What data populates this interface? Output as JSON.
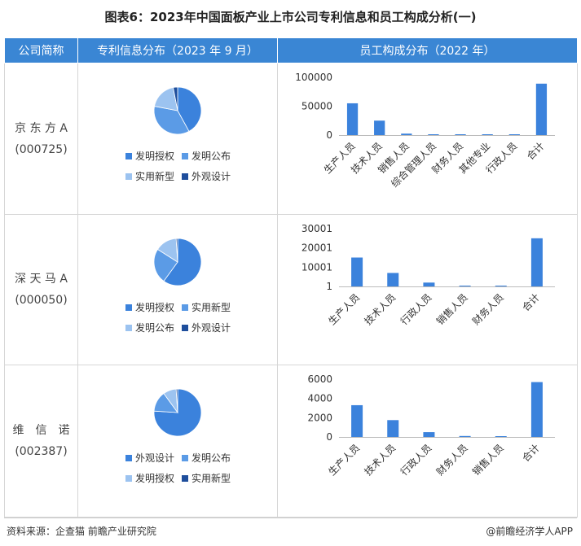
{
  "title": "图表6：2023年中国面板产业上市公司专利信息和员工构成分析(一)",
  "headers": {
    "company": "公司简称",
    "patent": "专利信息分布（2023 年 9 月）",
    "staff": "员工构成分布（2022 年）"
  },
  "rows": [
    {
      "company_name": "京 东 方 A",
      "company_code": "(000725)"
    },
    {
      "company_name": "深 天 马 A",
      "company_code": "(000050)"
    },
    {
      "company_name": "维　信　诺",
      "company_code": "(002387)"
    }
  ],
  "footer": {
    "source": "资料来源：企查猫 前瞻产业研究院",
    "brand": "@前瞻经济学人APP"
  },
  "colors": {
    "header": "#3a86d4",
    "bar": "#3b82dc"
  },
  "chart_data": [
    {
      "type": "pie",
      "company": "京东方A",
      "categories": [
        "发明授权",
        "发明公布",
        "实用新型",
        "外观设计"
      ],
      "values": [
        42,
        36,
        19,
        3
      ],
      "colors": [
        "#3b82dc",
        "#5b9be6",
        "#9cc3f0",
        "#1e4e9c"
      ]
    },
    {
      "type": "bar",
      "company": "京东方A",
      "categories": [
        "生产人员",
        "技术人员",
        "销售人员",
        "综合管理人员",
        "财务人员",
        "其他专业",
        "行政人员",
        "合计"
      ],
      "values": [
        55000,
        25000,
        2500,
        1000,
        900,
        700,
        800,
        89000
      ],
      "ylim": [
        0,
        100000
      ],
      "yticks": [
        "0",
        "50000",
        "100000"
      ],
      "yscale": "linear"
    },
    {
      "type": "pie",
      "company": "深天马A",
      "categories": [
        "发明授权",
        "实用新型",
        "发明公布",
        "外观设计"
      ],
      "values": [
        60,
        24,
        15,
        1
      ],
      "colors": [
        "#3b82dc",
        "#5b9be6",
        "#9cc3f0",
        "#1e4e9c"
      ]
    },
    {
      "type": "bar",
      "company": "深天马A",
      "categories": [
        "生产人员",
        "技术人员",
        "行政人员",
        "销售人员",
        "财务人员",
        "合计"
      ],
      "values": [
        15000,
        7000,
        2000,
        300,
        150,
        25000
      ],
      "ylim": [
        1,
        30001
      ],
      "yticks": [
        "1",
        "10001",
        "20001",
        "30001"
      ],
      "yscale": "linear"
    },
    {
      "type": "pie",
      "company": "维信诺",
      "categories": [
        "外观设计",
        "发明公布",
        "发明授权",
        "实用新型"
      ],
      "values": [
        76,
        14,
        9,
        1
      ],
      "colors": [
        "#3b82dc",
        "#5b9be6",
        "#9cc3f0",
        "#1e4e9c"
      ]
    },
    {
      "type": "bar",
      "company": "维信诺",
      "categories": [
        "生产人员",
        "技术人员",
        "行政人员",
        "财务人员",
        "销售人员",
        "合计"
      ],
      "values": [
        3300,
        1750,
        500,
        100,
        50,
        5700
      ],
      "ylim": [
        0,
        6000
      ],
      "yticks": [
        "0",
        "2000",
        "4000",
        "6000"
      ],
      "yscale": "linear"
    }
  ]
}
